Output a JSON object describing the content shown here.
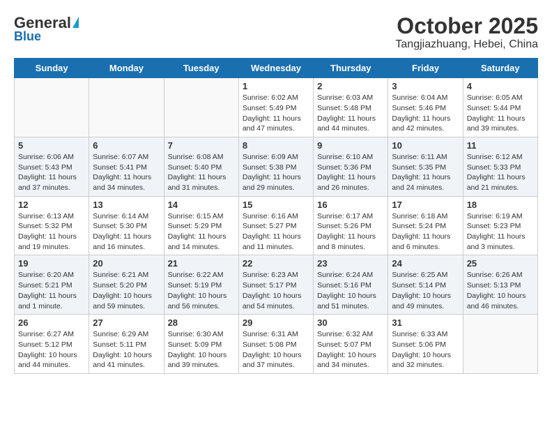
{
  "header": {
    "logo_general": "General",
    "logo_blue": "Blue",
    "month_title": "October 2025",
    "subtitle": "Tangjiazhuang, Hebei, China"
  },
  "days_of_week": [
    "Sunday",
    "Monday",
    "Tuesday",
    "Wednesday",
    "Thursday",
    "Friday",
    "Saturday"
  ],
  "weeks": [
    [
      {
        "day": "",
        "info": ""
      },
      {
        "day": "",
        "info": ""
      },
      {
        "day": "",
        "info": ""
      },
      {
        "day": "1",
        "info": "Sunrise: 6:02 AM\nSunset: 5:49 PM\nDaylight: 11 hours and 47 minutes."
      },
      {
        "day": "2",
        "info": "Sunrise: 6:03 AM\nSunset: 5:48 PM\nDaylight: 11 hours and 44 minutes."
      },
      {
        "day": "3",
        "info": "Sunrise: 6:04 AM\nSunset: 5:46 PM\nDaylight: 11 hours and 42 minutes."
      },
      {
        "day": "4",
        "info": "Sunrise: 6:05 AM\nSunset: 5:44 PM\nDaylight: 11 hours and 39 minutes."
      }
    ],
    [
      {
        "day": "5",
        "info": "Sunrise: 6:06 AM\nSunset: 5:43 PM\nDaylight: 11 hours and 37 minutes."
      },
      {
        "day": "6",
        "info": "Sunrise: 6:07 AM\nSunset: 5:41 PM\nDaylight: 11 hours and 34 minutes."
      },
      {
        "day": "7",
        "info": "Sunrise: 6:08 AM\nSunset: 5:40 PM\nDaylight: 11 hours and 31 minutes."
      },
      {
        "day": "8",
        "info": "Sunrise: 6:09 AM\nSunset: 5:38 PM\nDaylight: 11 hours and 29 minutes."
      },
      {
        "day": "9",
        "info": "Sunrise: 6:10 AM\nSunset: 5:36 PM\nDaylight: 11 hours and 26 minutes."
      },
      {
        "day": "10",
        "info": "Sunrise: 6:11 AM\nSunset: 5:35 PM\nDaylight: 11 hours and 24 minutes."
      },
      {
        "day": "11",
        "info": "Sunrise: 6:12 AM\nSunset: 5:33 PM\nDaylight: 11 hours and 21 minutes."
      }
    ],
    [
      {
        "day": "12",
        "info": "Sunrise: 6:13 AM\nSunset: 5:32 PM\nDaylight: 11 hours and 19 minutes."
      },
      {
        "day": "13",
        "info": "Sunrise: 6:14 AM\nSunset: 5:30 PM\nDaylight: 11 hours and 16 minutes."
      },
      {
        "day": "14",
        "info": "Sunrise: 6:15 AM\nSunset: 5:29 PM\nDaylight: 11 hours and 14 minutes."
      },
      {
        "day": "15",
        "info": "Sunrise: 6:16 AM\nSunset: 5:27 PM\nDaylight: 11 hours and 11 minutes."
      },
      {
        "day": "16",
        "info": "Sunrise: 6:17 AM\nSunset: 5:26 PM\nDaylight: 11 hours and 8 minutes."
      },
      {
        "day": "17",
        "info": "Sunrise: 6:18 AM\nSunset: 5:24 PM\nDaylight: 11 hours and 6 minutes."
      },
      {
        "day": "18",
        "info": "Sunrise: 6:19 AM\nSunset: 5:23 PM\nDaylight: 11 hours and 3 minutes."
      }
    ],
    [
      {
        "day": "19",
        "info": "Sunrise: 6:20 AM\nSunset: 5:21 PM\nDaylight: 11 hours and 1 minute."
      },
      {
        "day": "20",
        "info": "Sunrise: 6:21 AM\nSunset: 5:20 PM\nDaylight: 10 hours and 59 minutes."
      },
      {
        "day": "21",
        "info": "Sunrise: 6:22 AM\nSunset: 5:19 PM\nDaylight: 10 hours and 56 minutes."
      },
      {
        "day": "22",
        "info": "Sunrise: 6:23 AM\nSunset: 5:17 PM\nDaylight: 10 hours and 54 minutes."
      },
      {
        "day": "23",
        "info": "Sunrise: 6:24 AM\nSunset: 5:16 PM\nDaylight: 10 hours and 51 minutes."
      },
      {
        "day": "24",
        "info": "Sunrise: 6:25 AM\nSunset: 5:14 PM\nDaylight: 10 hours and 49 minutes."
      },
      {
        "day": "25",
        "info": "Sunrise: 6:26 AM\nSunset: 5:13 PM\nDaylight: 10 hours and 46 minutes."
      }
    ],
    [
      {
        "day": "26",
        "info": "Sunrise: 6:27 AM\nSunset: 5:12 PM\nDaylight: 10 hours and 44 minutes."
      },
      {
        "day": "27",
        "info": "Sunrise: 6:29 AM\nSunset: 5:11 PM\nDaylight: 10 hours and 41 minutes."
      },
      {
        "day": "28",
        "info": "Sunrise: 6:30 AM\nSunset: 5:09 PM\nDaylight: 10 hours and 39 minutes."
      },
      {
        "day": "29",
        "info": "Sunrise: 6:31 AM\nSunset: 5:08 PM\nDaylight: 10 hours and 37 minutes."
      },
      {
        "day": "30",
        "info": "Sunrise: 6:32 AM\nSunset: 5:07 PM\nDaylight: 10 hours and 34 minutes."
      },
      {
        "day": "31",
        "info": "Sunrise: 6:33 AM\nSunset: 5:06 PM\nDaylight: 10 hours and 32 minutes."
      },
      {
        "day": "",
        "info": ""
      }
    ]
  ]
}
